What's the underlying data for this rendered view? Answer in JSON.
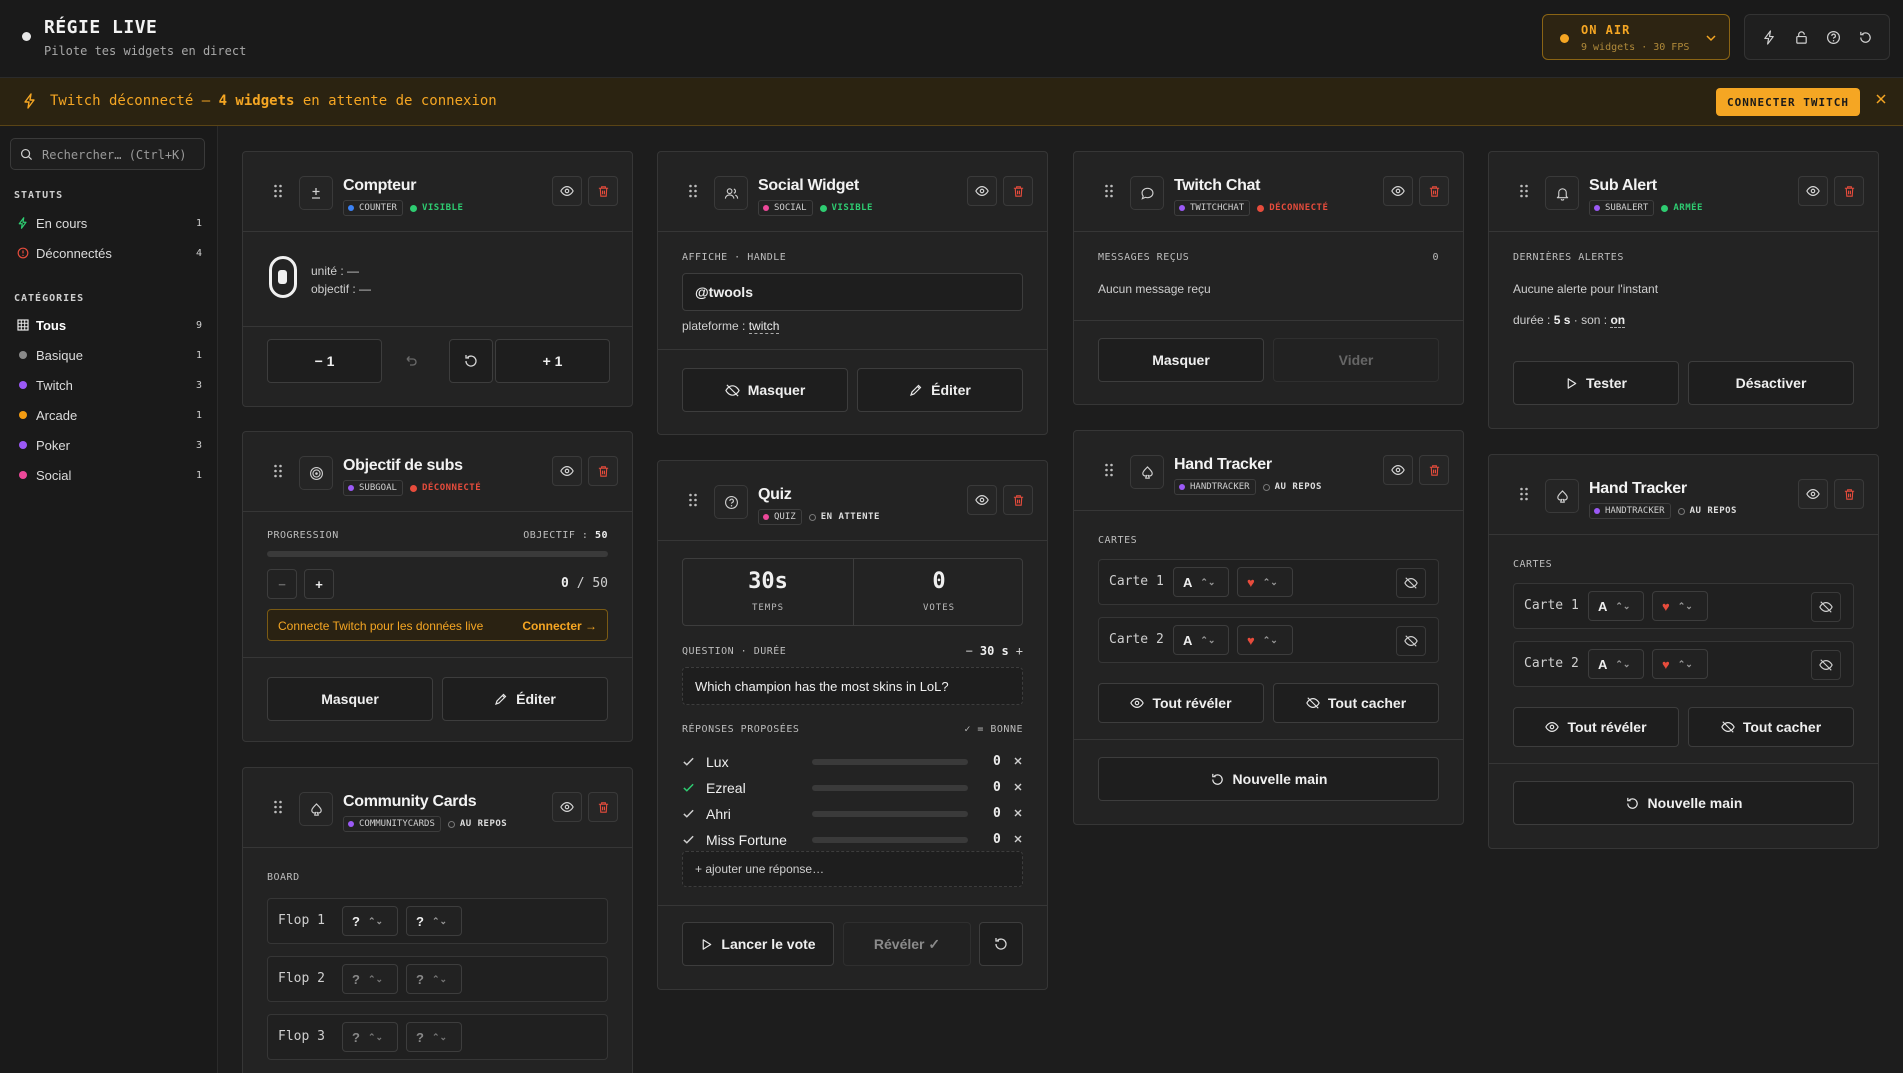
{
  "header": {
    "title": "RÉGIE LIVE",
    "subtitle": "Pilote tes widgets en direct",
    "onair_label": "ON AIR",
    "onair_meta": "9 widgets · 30 FPS"
  },
  "banner": {
    "prefix": "Twitch déconnecté — ",
    "count": "4 widgets",
    "suffix": " en attente de connexion",
    "connect_label": "CONNECTER TWITCH"
  },
  "sidebar": {
    "search_placeholder": "Rechercher… (Ctrl+K)",
    "statuts_title": "STATUTS",
    "statuts": [
      {
        "label": "En cours",
        "count": "1"
      },
      {
        "label": "Déconnectés",
        "count": "4"
      }
    ],
    "categories_title": "CATÉGORIES",
    "categories": [
      {
        "label": "Tous",
        "count": "9",
        "color": "#e8e8e8"
      },
      {
        "label": "Basique",
        "count": "1",
        "color": "#8a8a8a"
      },
      {
        "label": "Twitch",
        "count": "3",
        "color": "#9b59f6"
      },
      {
        "label": "Arcade",
        "count": "1",
        "color": "#f39c12"
      },
      {
        "label": "Poker",
        "count": "3",
        "color": "#9b59f6"
      },
      {
        "label": "Social",
        "count": "1",
        "color": "#ec4899"
      }
    ]
  },
  "colors": {
    "accent": "#f5a623",
    "ok": "#2ecc71",
    "error": "#e74c3c",
    "twitch": "#9b59f6",
    "social": "#ec4899",
    "basic": "#3b82f6"
  },
  "compteur": {
    "title": "Compteur",
    "tag": "COUNTER",
    "status": "VISIBLE",
    "value": "0",
    "unit": "unité : —",
    "goal": "objectif : —",
    "minus": "− 1",
    "plus": "+ 1"
  },
  "subgoal": {
    "title": "Objectif de subs",
    "tag": "SUBGOAL",
    "status": "DÉCONNECTÉ",
    "progress_label": "PROGRESSION",
    "goal_label": "OBJECTIF :",
    "goal_value": "50",
    "progress": 0,
    "current": "0",
    "slash": "/",
    "total": "50",
    "notice": "Connecte Twitch pour les données live",
    "notice_link": "Connecter →",
    "hide_label": "Masquer",
    "edit_label": "Éditer"
  },
  "community": {
    "title": "Community Cards",
    "tag": "COMMUNITYCARDS",
    "status": "AU REPOS",
    "board_label": "BOARD",
    "rows": [
      {
        "label": "Flop 1",
        "a": "?",
        "b": "?"
      },
      {
        "label": "Flop 2",
        "a": "?",
        "b": "?"
      },
      {
        "label": "Flop 3",
        "a": "?",
        "b": "?"
      }
    ]
  },
  "social": {
    "title": "Social Widget",
    "tag": "SOCIAL",
    "status": "VISIBLE",
    "field_label": "AFFICHE · HANDLE",
    "handle": "@twools",
    "platform_label": "plateforme :",
    "platform": "twitch",
    "hide_label": "Masquer",
    "edit_label": "Éditer"
  },
  "quiz": {
    "title": "Quiz",
    "tag": "QUIZ",
    "status": "EN ATTENTE",
    "time_value": "30s",
    "time_label": "TEMPS",
    "votes_value": "0",
    "votes_label": "VOTES",
    "question_label": "QUESTION · DURÉE",
    "duration_minus": "−",
    "duration": "30 s",
    "duration_plus": "+",
    "question": "Which champion has the most skins in LoL?",
    "answers_label": "RÉPONSES PROPOSÉES",
    "answers_legend": "✓ = BONNE",
    "answers": [
      {
        "label": "Lux",
        "count": "0",
        "correct": false
      },
      {
        "label": "Ezreal",
        "count": "0",
        "correct": true
      },
      {
        "label": "Ahri",
        "count": "0",
        "correct": false
      },
      {
        "label": "Miss Fortune",
        "count": "0",
        "correct": false
      }
    ],
    "add_answer": "+ ajouter une réponse…",
    "start_label": "Lancer le vote",
    "reveal_label": "Révéler ✓"
  },
  "twitchchat": {
    "title": "Twitch Chat",
    "tag": "TWITCHCHAT",
    "status": "DÉCONNECTÉ",
    "messages_label": "MESSAGES REÇUS",
    "messages_count": "0",
    "empty": "Aucun message reçu",
    "hide_label": "Masquer",
    "clear_label": "Vider"
  },
  "handtracker1": {
    "title": "Hand Tracker",
    "tag": "HANDTRACKER",
    "status": "AU REPOS",
    "cards_label": "CARTES",
    "rows": [
      {
        "label": "Carte 1",
        "rank": "A",
        "suit": "♥"
      },
      {
        "label": "Carte 2",
        "rank": "A",
        "suit": "♥"
      }
    ],
    "reveal_all": "Tout révéler",
    "hide_all": "Tout cacher",
    "new_hand": "Nouvelle main"
  },
  "subalert": {
    "title": "Sub Alert",
    "tag": "SUBALERT",
    "status": "ARMÉE",
    "alerts_label": "DERNIÈRES ALERTES",
    "empty": "Aucune alerte pour l'instant",
    "duration_label": "durée :",
    "duration": "5 s",
    "sound_label": "· son :",
    "sound": "on",
    "test_label": "Tester",
    "disable_label": "Désactiver"
  },
  "handtracker2": {
    "title": "Hand Tracker",
    "tag": "HANDTRACKER",
    "status": "AU REPOS",
    "cards_label": "CARTES",
    "rows": [
      {
        "label": "Carte 1",
        "rank": "A",
        "suit": "♥"
      },
      {
        "label": "Carte 2",
        "rank": "A",
        "suit": "♥"
      }
    ],
    "reveal_all": "Tout révéler",
    "hide_all": "Tout cacher",
    "new_hand": "Nouvelle main"
  }
}
